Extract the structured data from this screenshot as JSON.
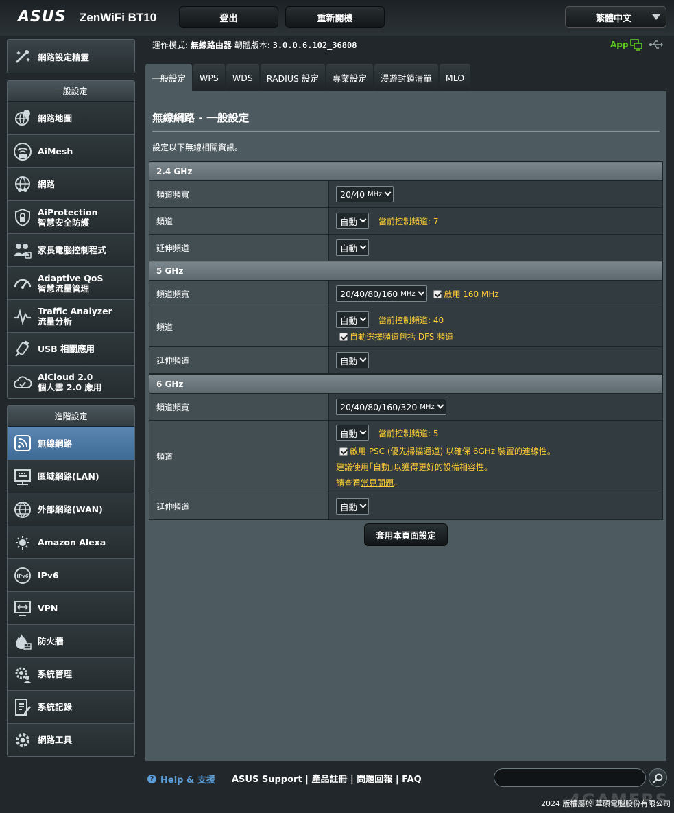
{
  "header": {
    "brand": "ASUS",
    "model": "ZenWiFi BT10",
    "logout": "登出",
    "reboot": "重新開機",
    "language": "繁體中文"
  },
  "status": {
    "mode_label": "運作模式:",
    "mode_value": "無線路由器",
    "fw_label": "韌體版本:",
    "fw_value": "3.0.0.6.102_36808",
    "app": "App"
  },
  "sidebar": {
    "wizard": "網路設定精靈",
    "general_header": "一般設定",
    "general": [
      {
        "l1": "網路地圖",
        "icon": "globe-map-icon"
      },
      {
        "l1": "AiMesh",
        "icon": "aimesh-icon"
      },
      {
        "l1": "網路",
        "icon": "globe-people-icon"
      },
      {
        "l1": "AiProtection",
        "l2": "智慧安全防護",
        "icon": "shield-icon"
      },
      {
        "l1": "家長電腦控制程式",
        "icon": "family-icon"
      },
      {
        "l1": "Adaptive QoS",
        "l2": "智慧流量管理",
        "icon": "gauge-icon"
      },
      {
        "l1": "Traffic Analyzer",
        "l2": "流量分析",
        "icon": "pulse-icon"
      },
      {
        "l1": "USB 相關應用",
        "icon": "usb-icon"
      },
      {
        "l1": "AiCloud 2.0",
        "l2": "個人雲 2.0 應用",
        "icon": "cloud-icon"
      }
    ],
    "advanced_header": "進階設定",
    "advanced": [
      {
        "l1": "無線網路",
        "icon": "wireless-icon",
        "active": true
      },
      {
        "l1": "區域網路(LAN)",
        "icon": "lan-icon"
      },
      {
        "l1": "外部網路(WAN)",
        "icon": "wan-globe-icon"
      },
      {
        "l1": "Amazon Alexa",
        "icon": "alexa-icon"
      },
      {
        "l1": "IPv6",
        "icon": "ipv6-icon"
      },
      {
        "l1": "VPN",
        "icon": "vpn-icon"
      },
      {
        "l1": "防火牆",
        "icon": "firewall-icon"
      },
      {
        "l1": "系統管理",
        "icon": "gear-person-icon"
      },
      {
        "l1": "系統記錄",
        "icon": "log-icon"
      },
      {
        "l1": "網路工具",
        "icon": "tools-gear-icon"
      }
    ]
  },
  "tabs": [
    "一般設定",
    "WPS",
    "WDS",
    "RADIUS 設定",
    "專業設定",
    "漫遊封鎖清單",
    "MLO"
  ],
  "panel": {
    "title": "無線網路 - 一般設定",
    "desc": "設定以下無線相關資訊。",
    "band24": {
      "header": "2.4 GHz",
      "bw_label": "頻道頻寬",
      "bw_value": "20/40",
      "bw_unit": "MHz",
      "ch_label": "頻道",
      "ch_value": "自動",
      "ch_note": "當前控制頻道: 7",
      "ext_label": "延伸頻道",
      "ext_value": "自動"
    },
    "band5": {
      "header": "5 GHz",
      "bw_label": "頻道頻寬",
      "bw_value": "20/40/80/160",
      "bw_unit": "MHz",
      "bw_check": "啟用 160 MHz",
      "ch_label": "頻道",
      "ch_value": "自動",
      "ch_note": "當前控制頻道: 40",
      "ch_check": "自動選擇頻道包括 DFS 頻道",
      "ext_label": "延伸頻道",
      "ext_value": "自動"
    },
    "band6": {
      "header": "6 GHz",
      "bw_label": "頻道頻寬",
      "bw_value": "20/40/80/160/320",
      "bw_unit": "MHz",
      "ch_label": "頻道",
      "ch_value": "自動",
      "ch_note": "當前控制頻道: 5",
      "ch_check": "啟用 PSC (優先掃描通道) 以確保 6GHz 裝置的連線性。",
      "ch_hint": "建議使用｢自動｣以獲得更好的設備相容性。",
      "ch_faq_pre": "請查看",
      "ch_faq_link": "常見問題",
      "ch_faq_post": "。",
      "ext_label": "延伸頻道",
      "ext_value": "自動"
    },
    "apply": "套用本頁面設定"
  },
  "footer": {
    "help": "Help & 支援",
    "links": [
      "ASUS Support",
      "產品註冊",
      "問題回報",
      "FAQ"
    ],
    "copyright": "2024 版權屬於 華碩電腦股份有限公司",
    "watermark": "4GAMERS"
  }
}
